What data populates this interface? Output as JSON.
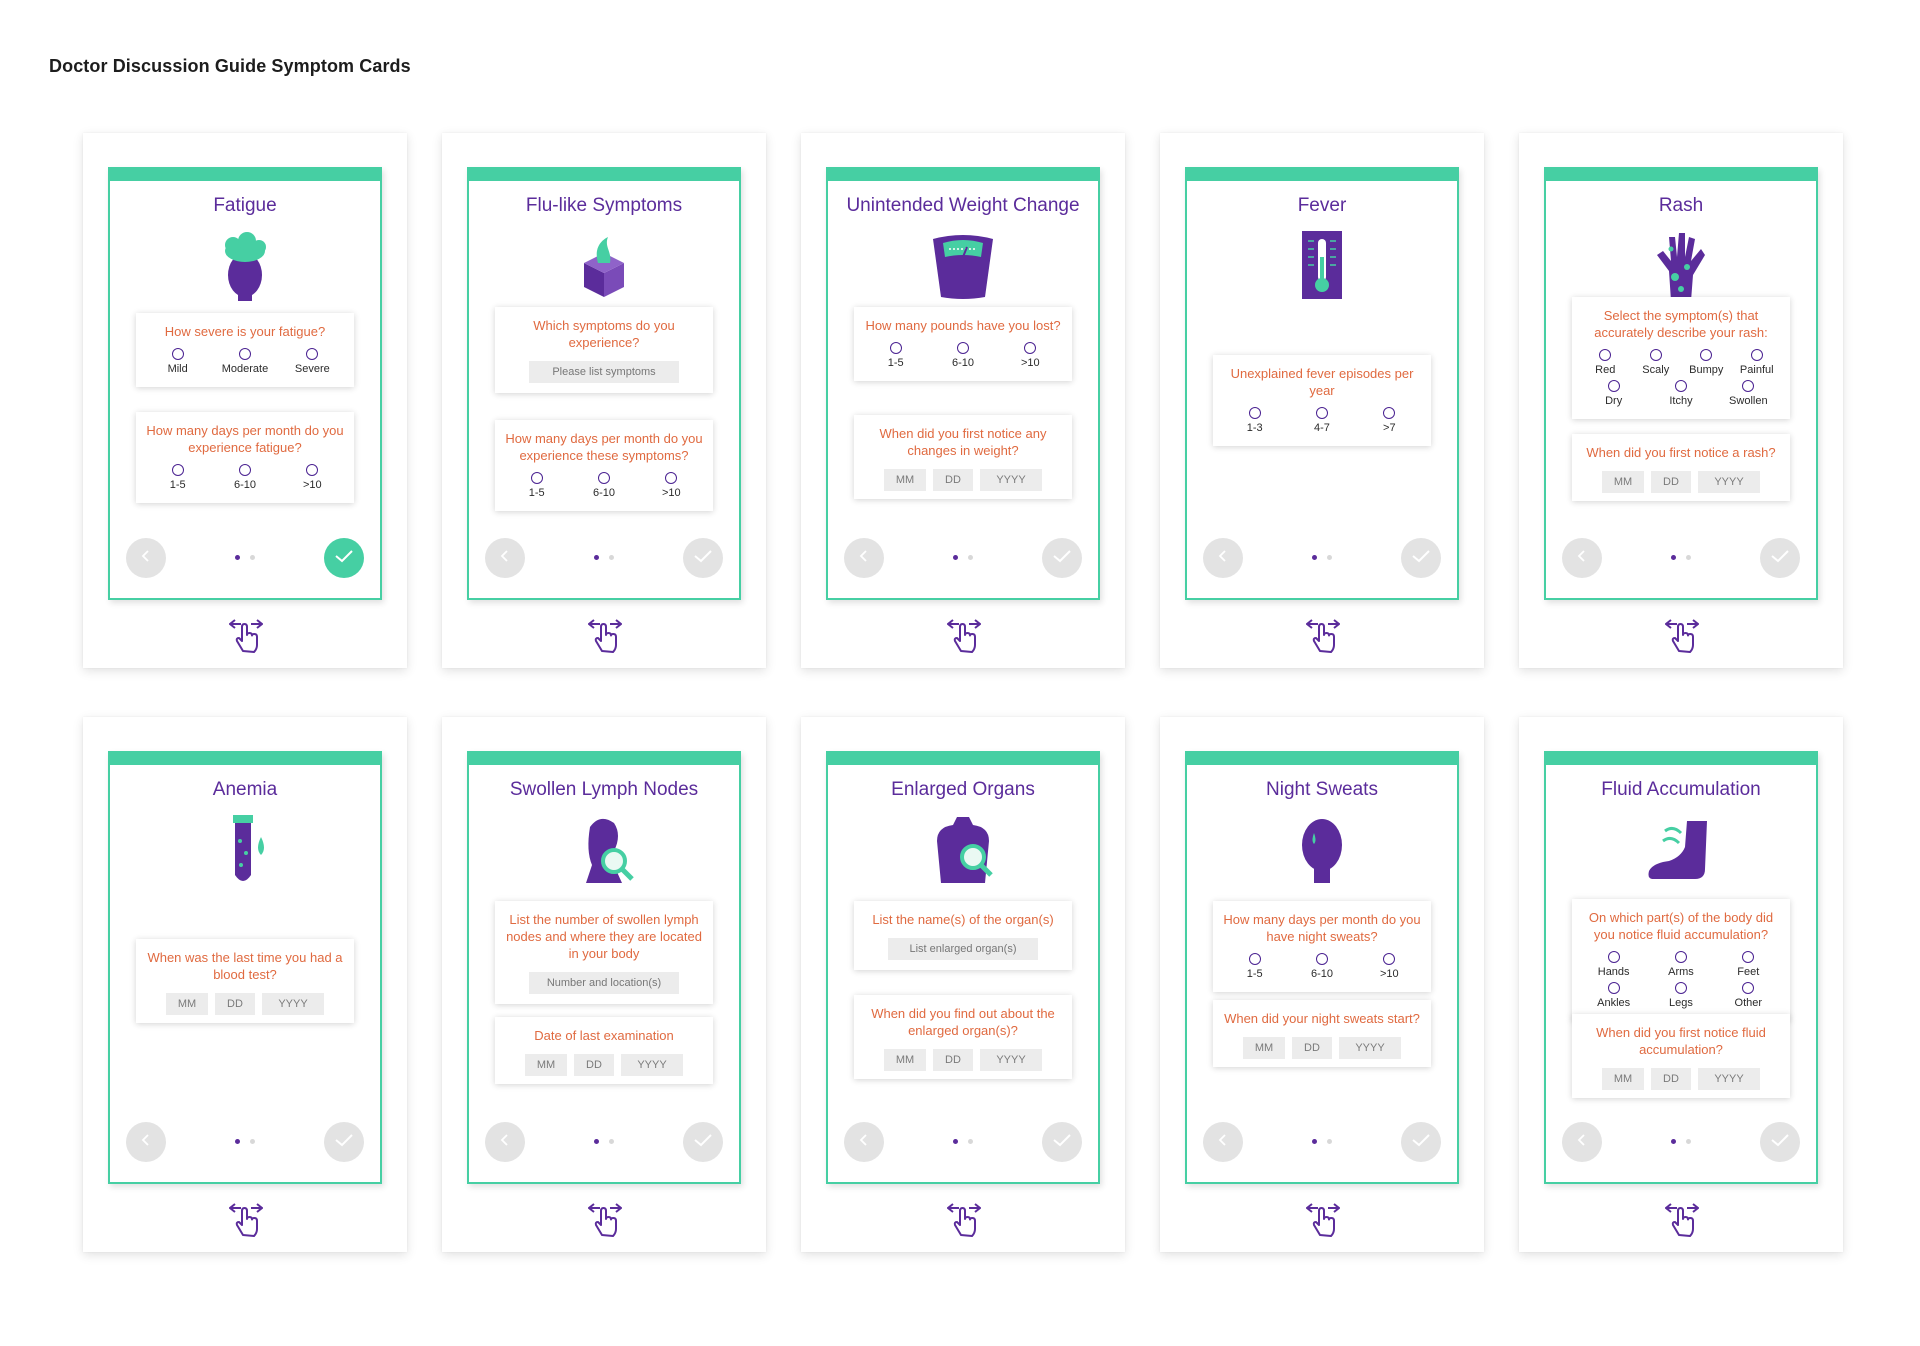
{
  "page": {
    "title": "Doctor Discussion Guide Symptom Cards"
  },
  "colors": {
    "accent": "#46cfa3",
    "purple": "#5b2c9b",
    "question": "#e06a40"
  },
  "cards": [
    {
      "title": "Fatigue",
      "icon": "head-icon",
      "finished": true,
      "questions": [
        {
          "text": "How severe is your fatigue?",
          "options": [
            "Mild",
            "Moderate",
            "Severe"
          ]
        },
        {
          "text": "How many days per month do you experience fatigue?",
          "options": [
            "1-5",
            "6-10",
            ">10"
          ]
        }
      ]
    },
    {
      "title": "Flu-like Symptoms",
      "icon": "tissue-box-icon",
      "questions": [
        {
          "text": "Which symptoms do you experience?",
          "field": "Please list symptoms"
        },
        {
          "text": "How many days per month do you experience these symptoms?",
          "options": [
            "1-5",
            "6-10",
            ">10"
          ]
        }
      ]
    },
    {
      "title": "Unintended Weight Change",
      "icon": "scale-icon",
      "questions": [
        {
          "text": "How many pounds have you lost?",
          "options": [
            "1-5",
            "6-10",
            ">10"
          ]
        },
        {
          "text": "When did you first notice any changes in weight?",
          "date": [
            "MM",
            "DD",
            "YYYY"
          ]
        }
      ]
    },
    {
      "title": "Fever",
      "icon": "thermometer-icon",
      "questions": [
        {
          "text": "Unexplained fever episodes per year",
          "options": [
            "1-3",
            "4-7",
            ">7"
          ]
        }
      ]
    },
    {
      "title": "Rash",
      "icon": "rash-hand-icon",
      "questions": [
        {
          "text": "Select the symptom(s) that accurately describe your rash:",
          "options": [
            "Red",
            "Scaly",
            "Bumpy",
            "Painful",
            "Dry",
            "Itchy",
            "Swollen"
          ]
        },
        {
          "text": "When did you first notice a rash?",
          "date": [
            "MM",
            "DD",
            "YYYY"
          ]
        }
      ]
    },
    {
      "title": "Anemia",
      "icon": "blood-tube-icon",
      "questions": [
        {
          "text": "When was the last time you had a blood test?",
          "date": [
            "MM",
            "DD",
            "YYYY"
          ]
        }
      ]
    },
    {
      "title": "Swollen Lymph Nodes",
      "icon": "neck-magnifier-icon",
      "questions": [
        {
          "text": "List the number of swollen lymph nodes and where they are located in your body",
          "field": "Number and location(s)"
        },
        {
          "text": "Date of last examination",
          "date": [
            "MM",
            "DD",
            "YYYY"
          ]
        }
      ]
    },
    {
      "title": "Enlarged Organs",
      "icon": "torso-magnifier-icon",
      "questions": [
        {
          "text": "List the name(s) of the organ(s)",
          "field": "List enlarged organ(s)"
        },
        {
          "text": "When did you find out about the enlarged organ(s)?",
          "date": [
            "MM",
            "DD",
            "YYYY"
          ]
        }
      ]
    },
    {
      "title": "Night Sweats",
      "icon": "sweating-head-icon",
      "questions": [
        {
          "text": "How many days per month do you have night sweats?",
          "options": [
            "1-5",
            "6-10",
            ">10"
          ]
        },
        {
          "text": "When did your night sweats start?",
          "date": [
            "MM",
            "DD",
            "YYYY"
          ]
        }
      ]
    },
    {
      "title": "Fluid Accumulation",
      "icon": "swollen-foot-icon",
      "questions": [
        {
          "text": "On which part(s) of the body did you notice fluid accumulation?",
          "options": [
            "Hands",
            "Arms",
            "Feet",
            "Ankles",
            "Legs",
            "Other"
          ]
        },
        {
          "text": "When did you first notice fluid accumulation?",
          "date": [
            "MM",
            "DD",
            "YYYY"
          ]
        }
      ]
    }
  ]
}
